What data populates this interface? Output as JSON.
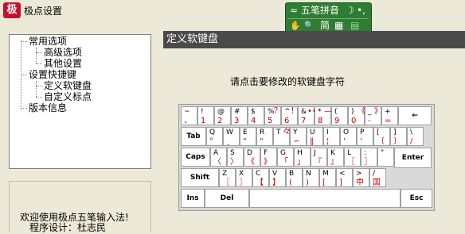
{
  "window": {
    "title": "极点设置",
    "app_icon": "极"
  },
  "ime_bar": {
    "row1": [
      "≈",
      "五笔拼音",
      "☽",
      "•,"
    ],
    "row2": [
      "✋",
      "🔍",
      "简",
      "▦",
      "▤"
    ]
  },
  "tree": {
    "items": [
      {
        "label": "常用选项"
      },
      {
        "label": "高级选项"
      },
      {
        "label": "其他设置"
      },
      {
        "label": "设置快捷键"
      },
      {
        "label": "定义软键盘"
      },
      {
        "label": "自定义标点"
      },
      {
        "label": "版本信息"
      }
    ]
  },
  "info": {
    "line1": "欢迎使用极点五笔输入法!",
    "line2": "程序设计：杜志民"
  },
  "panel": {
    "title": "定义软键盘",
    "prompt": "请点击要修改的软键盘字符"
  },
  "keyboard": {
    "row1": [
      {
        "up": "~",
        "lo": "、"
      },
      {
        "up": "!",
        "lo": "1",
        "top2": ""
      },
      {
        "up": "@",
        "lo": "2"
      },
      {
        "up": "#",
        "lo": "3"
      },
      {
        "up": "$",
        "lo": "4"
      },
      {
        "up": "%",
        "lo": "5",
        "top2": "？"
      },
      {
        "up": "^",
        "lo": "6",
        "top2": "！"
      },
      {
        "up": "&",
        "lo": "7",
        "top2": "•••"
      },
      {
        "up": "*",
        "lo": "8",
        "top2": "—"
      },
      {
        "up": "(",
        "lo": "9"
      },
      {
        "up": ")",
        "lo": "0",
        "top2": "《"
      },
      {
        "up": "_",
        "lo": "-",
        "top2": "》"
      },
      {
        "up": "+",
        "lo": "="
      }
    ],
    "backspace": "←",
    "tab": "Tab",
    "row2": [
      {
        "up": "Q",
        "lo": "°"
      },
      {
        "up": "W",
        "lo": "¸"
      },
      {
        "up": "E",
        "lo": "\""
      },
      {
        "up": "R",
        "lo": "\""
      },
      {
        "up": "T",
        "lo": "",
        "top2": "々"
      },
      {
        "up": "Y",
        "lo": "∽"
      },
      {
        "up": "U",
        "lo": "‖"
      },
      {
        "up": "I",
        "lo": "¦"
      },
      {
        "up": "O",
        "lo": "'"
      },
      {
        "up": "P",
        "lo": "'"
      },
      {
        "up": "[",
        "lo": "〔"
      },
      {
        "up": "]",
        "lo": "〕"
      },
      {
        "up": "\\",
        "lo": "/"
      }
    ],
    "caps": "Caps",
    "row3": [
      {
        "up": "A",
        "lo": "〈"
      },
      {
        "up": "S",
        "lo": "〉"
      },
      {
        "up": "D",
        "lo": "《"
      },
      {
        "up": "F",
        "lo": "》"
      },
      {
        "up": "G",
        "lo": "「"
      },
      {
        "up": "H",
        "lo": "」"
      },
      {
        "up": "J",
        "lo": "『"
      },
      {
        "up": "K",
        "lo": "』"
      },
      {
        "up": "L",
        "lo": "〖"
      },
      {
        "up": ":",
        "lo": "〗"
      },
      {
        "up": "\"",
        "lo": ""
      }
    ],
    "enter": "Enter",
    "shift": "Shift",
    "row4": [
      {
        "up": "Z",
        "lo": "〖"
      },
      {
        "up": "X",
        "lo": "〗"
      },
      {
        "up": "C",
        "lo": "【"
      },
      {
        "up": "V",
        "lo": "】"
      },
      {
        "up": "B",
        "lo": "("
      },
      {
        "up": "N",
        "lo": ")"
      },
      {
        "up": "M",
        "lo": "["
      },
      {
        "up": "<",
        "lo": "]"
      },
      {
        "up": ">",
        "lo": "中"
      },
      {
        "up": "/",
        "lo": "国"
      }
    ],
    "ins": "Ins",
    "del": "Del",
    "esc": "Esc"
  },
  "colors": {
    "ime_bg": "#2f7d32",
    "panel_head": "#4a4a4a",
    "key_char": "#c00000"
  }
}
